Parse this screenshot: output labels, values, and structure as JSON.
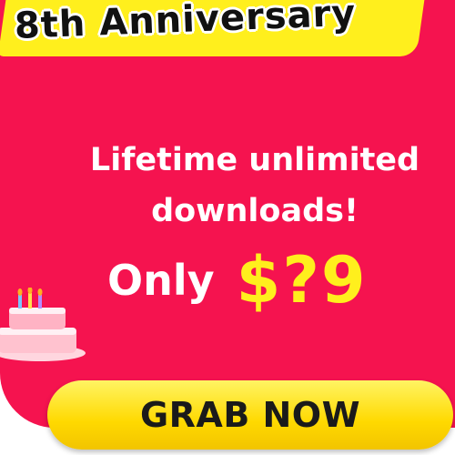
{
  "banner": {
    "title": "8th Anniversary"
  },
  "offer": {
    "line1": "Lifetime unlimited",
    "line2": "downloads!",
    "only_label": "Only",
    "price": "$?9"
  },
  "cta": {
    "label": "GRAB NOW"
  },
  "icons": {
    "cake": "birthday-cake-icon"
  },
  "colors": {
    "background": "#f5134f",
    "banner": "#ffef1d",
    "price": "#ffef1d",
    "button": "#ffd900",
    "text_light": "#ffffff",
    "text_dark": "#111111"
  }
}
